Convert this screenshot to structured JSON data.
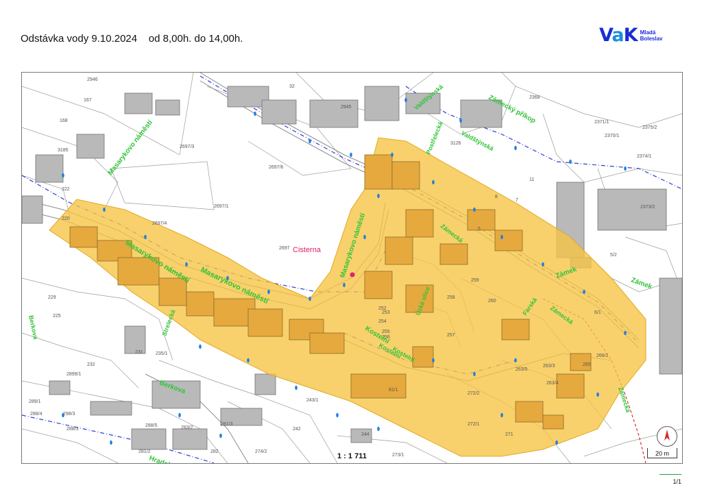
{
  "header": {
    "title": "Odstávka vody 9.10.2024    od 8,00h. do 14,00h."
  },
  "logo": {
    "mark": "VaK",
    "line1": "Mladá",
    "line2": "Boleslav",
    "brand_color": "#1a2bd6"
  },
  "map": {
    "outage_zone_color": "#f6c443",
    "street_label_color": "#2fc437",
    "building_color": "#b9b9b9",
    "poi_color": "#e0206e",
    "streets": [
      "Masarykovo náměstí",
      "Masarykovo náměstí",
      "Masarykovo náměstí",
      "Masarykovo náměstí",
      "Kostelní",
      "Kostelní",
      "Zámecká",
      "Zámecká",
      "Zámecká",
      "Zámecký příkop",
      "Valdštýnská",
      "Valdštýnská",
      "Zámek",
      "Zámek",
      "Farská",
      "Úzká ulice",
      "Berkova",
      "Berkova",
      "Hradební",
      "Strelecká",
      "Kostelní",
      "Postřelecká"
    ],
    "poi_label": "Cisterna",
    "parcels": [
      "2946",
      "167",
      "168",
      "3185",
      "2697/3",
      "2697/6",
      "2697/1",
      "2697/4",
      "2697",
      "2368",
      "2371/1",
      "2370/1",
      "2375/2",
      "2374/1",
      "2373/2",
      "5/2",
      "6/1",
      "11",
      "8",
      "7",
      "3126",
      "2945",
      "32",
      "222",
      "220",
      "229",
      "225",
      "231",
      "232",
      "235/1",
      "2899/1",
      "289/1",
      "288/4",
      "298/3",
      "288/3",
      "288/5",
      "283/2",
      "281/3",
      "282",
      "281/2",
      "274/2",
      "273/1",
      "244",
      "243/1",
      "242",
      "257",
      "260",
      "259",
      "258",
      "263/3",
      "263/4",
      "263/5",
      "266/1",
      "271",
      "272/2",
      "272/1",
      "265",
      "81/1",
      "252",
      "253",
      "254",
      "255",
      "256",
      "5"
    ],
    "scale_ratio": "1 : 1 711",
    "scale_bar": "20 m",
    "compass": "north-arrow-icon"
  },
  "footer": {
    "page": "1/1"
  }
}
